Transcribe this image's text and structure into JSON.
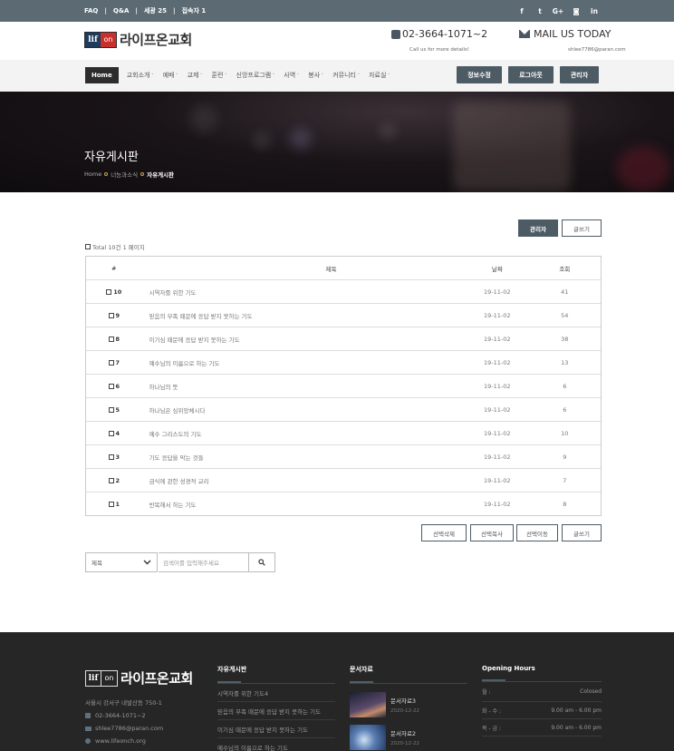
{
  "topbar": {
    "links": [
      "FAQ",
      "Q&A",
      "세광 25",
      "접속자 1"
    ],
    "social_icons": [
      "facebook-icon",
      "twitter-icon",
      "google-plus-icon",
      "instagram-icon",
      "linkedin-icon"
    ],
    "social_glyphs": [
      "f",
      "t",
      "G+",
      "◙",
      "in"
    ]
  },
  "header": {
    "logo_mark_left": "lif",
    "logo_mark_right": "on",
    "logo_text": "라이프온교회",
    "phone": "02-3664-1071~2",
    "phone_sub": "Call us for more details!",
    "mail_title": "MAIL US TODAY",
    "mail_sub": "shlee7786@paran.com"
  },
  "nav": {
    "home": "Home",
    "items": [
      "교회소개",
      "예배",
      "교제",
      "훈련",
      "신앙프로그램",
      "사역",
      "봉사",
      "커뮤니티",
      "자료실"
    ],
    "buttons": [
      "정보수정",
      "로그아웃",
      "관리자"
    ]
  },
  "banner": {
    "title": "자유게시판",
    "crumb_home": "Home",
    "crumb_mid": "너능과소식",
    "crumb_current": "자유게시판"
  },
  "board": {
    "admin_button": "관리자",
    "write_button": "글쓰기",
    "total": "Total 10건 1 페이지",
    "headers": {
      "num": "#",
      "title": "제목",
      "date": "날짜",
      "views": "조회"
    },
    "rows": [
      {
        "num": "10",
        "title": "시역자를 위한 기도",
        "date": "19-11-02",
        "views": "41"
      },
      {
        "num": "9",
        "title": "믿음의 부족 때문에 응답 받지 못하는 기도",
        "date": "19-11-02",
        "views": "54"
      },
      {
        "num": "8",
        "title": "이기심 때문에 응답 받지 못하는 기도",
        "date": "19-11-02",
        "views": "38"
      },
      {
        "num": "7",
        "title": "예수님의 이름으로 하는 기도",
        "date": "19-11-02",
        "views": "13"
      },
      {
        "num": "6",
        "title": "하나님의 뜻",
        "date": "19-11-02",
        "views": "6"
      },
      {
        "num": "5",
        "title": "하나님은 심위앙체시다",
        "date": "19-11-02",
        "views": "6"
      },
      {
        "num": "4",
        "title": "예수 그리스도의 기도",
        "date": "19-11-02",
        "views": "10"
      },
      {
        "num": "3",
        "title": "기도 응답을 막는 것들",
        "date": "19-11-02",
        "views": "9"
      },
      {
        "num": "2",
        "title": "금식에 관한 성경적 교리",
        "date": "19-11-02",
        "views": "7"
      },
      {
        "num": "1",
        "title": "반복해서 하는 기도",
        "date": "19-11-02",
        "views": "8"
      }
    ],
    "bottom_buttons": [
      "선택삭제",
      "선택복사",
      "선택이동",
      "글쓰기"
    ],
    "search_select": "제목",
    "search_placeholder": "검색어를 입력해주세요"
  },
  "footer": {
    "address": "서울시 강서구 내발산동 750-1",
    "phone": "02-3664-1071~2",
    "email": "shlee7786@paran.com",
    "website": "www.lifeonch.org",
    "board_title": "자유게시판",
    "board_items": [
      "시역자를 위한 기도4",
      "믿음의 부족 때문에 응답 받지 못하는 기도",
      "이기심 때문에 응답 받지 못하는 기도",
      "예수님의 이름으로 하는 기도"
    ],
    "docs_title": "문서자료",
    "docs": [
      {
        "title": "문서자료3",
        "date": "2020-12-22"
      },
      {
        "title": "문서자료2",
        "date": "2020-12-22"
      }
    ],
    "hours_title": "Opening Hours",
    "hours": [
      {
        "day": "월 :",
        "time": "Colosed"
      },
      {
        "day": "화 - 수 :",
        "time": "9.00 am - 6.00 pm"
      },
      {
        "day": "목 - 금 :",
        "time": "9.00 am - 6.00 pm"
      }
    ]
  },
  "colors": {
    "accent": "#4d5b64",
    "topbar": "#5b6a73",
    "footer": "#262626"
  }
}
